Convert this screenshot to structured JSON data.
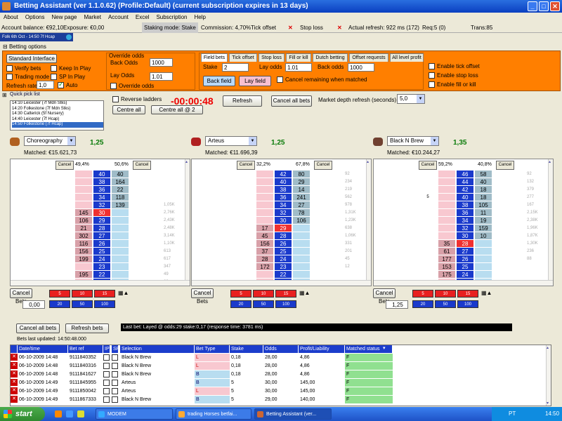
{
  "window": {
    "title": "Betting Assistant (ver 1.1.0.62)      (Profile:Default)      (current subscription expires in 13 days)",
    "min": "_",
    "max": "□",
    "close": "✕"
  },
  "menu": [
    "About",
    "Options",
    "New page",
    "Market",
    "Account",
    "Excel",
    "Subscription",
    "Help"
  ],
  "status": {
    "balance": "Account balance: €92,10",
    "exposure": "Exposure: €0,00",
    "staking": "Staking mode: Stake",
    "commission": "Commission: 4,70%",
    "tick_offset": "Tick offset",
    "stop_loss": "Stop loss",
    "refresh": "Actual refresh: 922 ms (172)",
    "req": "Req:5 (0)",
    "trans": "Trans:85",
    "x": "✕"
  },
  "race_tab": "Folk 6th Oct - 14:50 7f Hcap",
  "betting_options": {
    "header": "Betting options",
    "standard_interface": "Standard Interface",
    "verify_bets": "Verify bets",
    "keep_in_play": "Keep In Play",
    "trading_mode": "Trading mode",
    "sp_in_play": "SP In Play",
    "refresh_rate_label": "Refresh rate",
    "refresh_rate_value": "1,0",
    "auto": "Auto",
    "override_title": "Override odds",
    "back_odds_label": "Back Odds",
    "back_odds_value": "1000",
    "lay_odds_label": "Lay Odds",
    "lay_odds_value": "1.01",
    "override_odds": "Override odds",
    "tabs": [
      "Field bets",
      "Tick offset",
      "Stop loss",
      "Fill or kill",
      "Dutch betting",
      "Offset requests",
      "All level profit"
    ],
    "stake_label": "Stake",
    "stake_value": "2",
    "lay_odds2_label": "Lay odds",
    "lay_odds2_value": "1.01",
    "back_odds2_label": "Back odds",
    "back_odds2_value": "1000",
    "back_field": "Back field",
    "lay_field": "Lay field",
    "cancel_remaining": "Cancel remaining when matched",
    "enable_tick": "Enable tick offset",
    "enable_stop": "Enable stop loss",
    "enable_fill": "Enable fill or kill"
  },
  "quick_pick": {
    "title": "Quick pick list",
    "items": [
      "14:10 Leicester (7f Mdn Stks)",
      "14:20 Folkestone (7f Mdn Stks)",
      "14:30 Catterick (5f Nursery)",
      "14:40 Leicester (7f Hcap)",
      "14:50 Folkestone (7f Hcap)"
    ],
    "selected": 4
  },
  "controls": {
    "reverse_ladders": "Reverse ladders",
    "timer": "-00:00:48",
    "refresh": "Refresh",
    "cancel_all": "Cancel all bets",
    "centre_all": "Centre all",
    "centre_all2": "Centre all @ 2",
    "depth_label": "Market depth refresh (seconds)",
    "depth_value": "5,0"
  },
  "runners": [
    {
      "name": "Choreography",
      "odds": "1,25",
      "matched": "Matched: €15.621,73",
      "silk": "#b06020",
      "pct_left": "49,4%",
      "pct_right": "50,6%",
      "cancel": "Cancel",
      "rows": [
        [
          "",
          "",
          "40",
          "40",
          ""
        ],
        [
          "",
          "",
          "38",
          "164",
          ""
        ],
        [
          "",
          "",
          "36",
          "22",
          ""
        ],
        [
          "",
          "",
          "34",
          "118",
          ""
        ],
        [
          "",
          "",
          "32",
          "139",
          "1,05K"
        ],
        [
          "",
          "145",
          "30",
          "",
          "2,76K"
        ],
        [
          "",
          "106",
          "29",
          "",
          "2,43K"
        ],
        [
          "",
          "21",
          "28",
          "",
          "2,48K"
        ],
        [
          "",
          "302",
          "27",
          "",
          "3,14K"
        ],
        [
          "",
          "116",
          "26",
          "",
          "1,10K"
        ],
        [
          "",
          "156",
          "25",
          "",
          "613"
        ],
        [
          "",
          "199",
          "24",
          "",
          "617"
        ],
        [
          "",
          "",
          "23",
          "",
          "347"
        ],
        [
          "",
          "195",
          "22",
          "",
          "49"
        ],
        [
          "",
          "",
          "21",
          "",
          "29"
        ],
        [
          "",
          "94",
          "20",
          "",
          "218"
        ]
      ],
      "stake_value": "0,00"
    },
    {
      "name": "Arteus",
      "odds": "1,25",
      "matched": "Matched: €11.696,39",
      "silk": "#b02020",
      "pct_left": "32,2%",
      "pct_right": "67,8%",
      "cancel": "Cancel",
      "rows": [
        [
          "",
          "",
          "42",
          "80",
          "92"
        ],
        [
          "",
          "",
          "40",
          "29",
          "234"
        ],
        [
          "",
          "",
          "38",
          "14",
          "219"
        ],
        [
          "",
          "",
          "36",
          "241",
          "562"
        ],
        [
          "",
          "",
          "34",
          "27",
          "978"
        ],
        [
          "",
          "",
          "32",
          "78",
          "1,31K"
        ],
        [
          "",
          "",
          "30",
          "106",
          "1,23K"
        ],
        [
          "",
          "17",
          "29",
          "",
          "638"
        ],
        [
          "",
          "45",
          "28",
          "",
          "1,06K"
        ],
        [
          "",
          "156",
          "26",
          "",
          "331"
        ],
        [
          "",
          "37",
          "25",
          "",
          "201"
        ],
        [
          "",
          "28",
          "24",
          "",
          "45"
        ],
        [
          "",
          "172",
          "23",
          "",
          "12"
        ],
        [
          "",
          "",
          "22",
          "",
          ""
        ],
        [
          "",
          "",
          "21",
          "",
          ""
        ],
        [
          "",
          "189",
          "20",
          "",
          ""
        ]
      ],
      "stake_value": ""
    },
    {
      "name": "Black N Brew",
      "odds": "1,35",
      "matched": "Matched: €10.244,27",
      "silk": "#704030",
      "pct_left": "59,2%",
      "pct_right": "40,8%",
      "cancel": "Cancel",
      "rows": [
        [
          "",
          "",
          "46",
          "58",
          "92"
        ],
        [
          "",
          "",
          "44",
          "40",
          "132"
        ],
        [
          "",
          "",
          "42",
          "18",
          "379"
        ],
        [
          "5",
          "",
          "40",
          "18",
          "277"
        ],
        [
          "",
          "",
          "38",
          "105",
          "167"
        ],
        [
          "",
          "",
          "36",
          "11",
          "2,15K"
        ],
        [
          "",
          "",
          "34",
          "19",
          "2,38K"
        ],
        [
          "",
          "",
          "32",
          "159",
          "1,96K"
        ],
        [
          "",
          "",
          "30",
          "10",
          "1,87K"
        ],
        [
          "",
          "35",
          "28",
          "",
          "1,30K"
        ],
        [
          "",
          "61",
          "27",
          "",
          "236"
        ],
        [
          "",
          "177",
          "26",
          "",
          "88"
        ],
        [
          "",
          "153",
          "25",
          "",
          ""
        ],
        [
          "",
          "175",
          "24",
          "",
          ""
        ],
        [
          "",
          "",
          "23",
          "",
          ""
        ],
        [
          "",
          "",
          "22",
          "",
          ""
        ]
      ],
      "stake_value": "1,25"
    }
  ],
  "stake_buttons": {
    "cancel": "Cancel Bets",
    "red": [
      "5",
      "10",
      "15"
    ],
    "blue": [
      "20",
      "50",
      "100"
    ]
  },
  "bottom": {
    "cancel_all": "Cancel all bets",
    "refresh_bets": "Refresh bets",
    "last_bet": "Last bet: Layed  @ odds:29 stake:0,17 (response time: 3781 ms)",
    "updated": "Bets last updated: 14:50:48.000"
  },
  "grid": {
    "headers": [
      "Date/time",
      "Bet ref",
      "IP",
      "SP",
      "Selection",
      "Bet Type",
      "Stake",
      "Odds",
      "Profit/Liability",
      "Matched status"
    ],
    "rows": [
      [
        "06-10-2009 14:48",
        "9111840352",
        "Black N Brew",
        "L",
        "0,18",
        "28,00",
        "4,86",
        "F"
      ],
      [
        "06-10-2009 14:48",
        "9111840316",
        "Black N Brew",
        "L",
        "0,18",
        "28,00",
        "4,86",
        "F"
      ],
      [
        "06-10-2009 14:48",
        "9111841627",
        "Black N Brew",
        "B",
        "0,18",
        "28,00",
        "4,86",
        "F"
      ],
      [
        "06-10-2009 14:49",
        "9111845955",
        "Arteus",
        "B",
        "5",
        "30,00",
        "145,00",
        "F"
      ],
      [
        "06-10-2009 14:49",
        "9111850042",
        "Arteus",
        "L",
        "5",
        "30,00",
        "145,00",
        "F"
      ],
      [
        "06-10-2009 14:49",
        "9111867333",
        "Black N Brew",
        "B",
        "5",
        "29,00",
        "140,00",
        "F"
      ]
    ]
  },
  "taskbar": {
    "start": "start",
    "tasks": [
      "MODEM",
      "trading Horses betfai...",
      "Betting Assistant (ver..."
    ],
    "lang": "PT",
    "clock": "14:50"
  }
}
